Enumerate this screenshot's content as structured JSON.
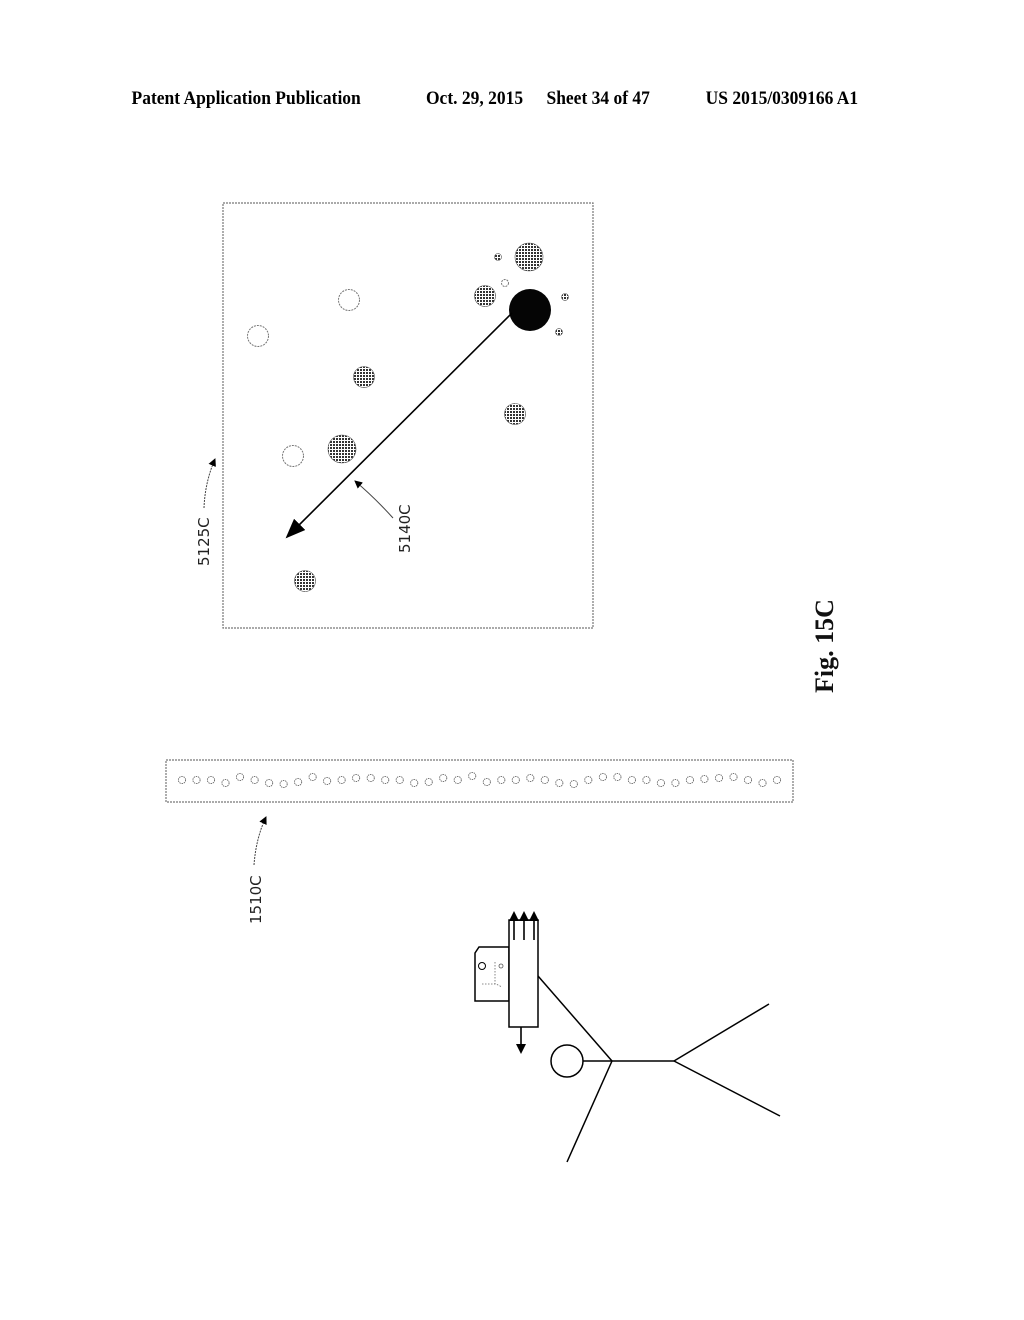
{
  "header": {
    "publication": "Patent Application Publication",
    "date": "Oct. 29, 2015",
    "sheet": "Sheet 34 of 47",
    "number": "US 2015/0309166 A1"
  },
  "figure": {
    "caption": "Fig. 15C",
    "labels": {
      "view_panel": "5125C",
      "motion_vector": "5140C",
      "sensor_strip": "1510C"
    },
    "panel_objects": [
      {
        "kind": "shaded",
        "size": "large"
      },
      {
        "kind": "shaded",
        "size": "tiny"
      },
      {
        "kind": "hollow",
        "size": "tiny"
      },
      {
        "kind": "shaded",
        "size": "medium"
      },
      {
        "kind": "solid",
        "size": "xlarge"
      },
      {
        "kind": "shaded",
        "size": "tiny"
      },
      {
        "kind": "shaded",
        "size": "tiny"
      },
      {
        "kind": "hollow",
        "size": "medium"
      },
      {
        "kind": "hollow",
        "size": "medium"
      },
      {
        "kind": "shaded",
        "size": "medium"
      },
      {
        "kind": "shaded",
        "size": "medium"
      },
      {
        "kind": "hollow",
        "size": "medium"
      },
      {
        "kind": "shaded",
        "size": "large"
      },
      {
        "kind": "shaded",
        "size": "medium"
      }
    ],
    "strip_object_count": 42
  }
}
